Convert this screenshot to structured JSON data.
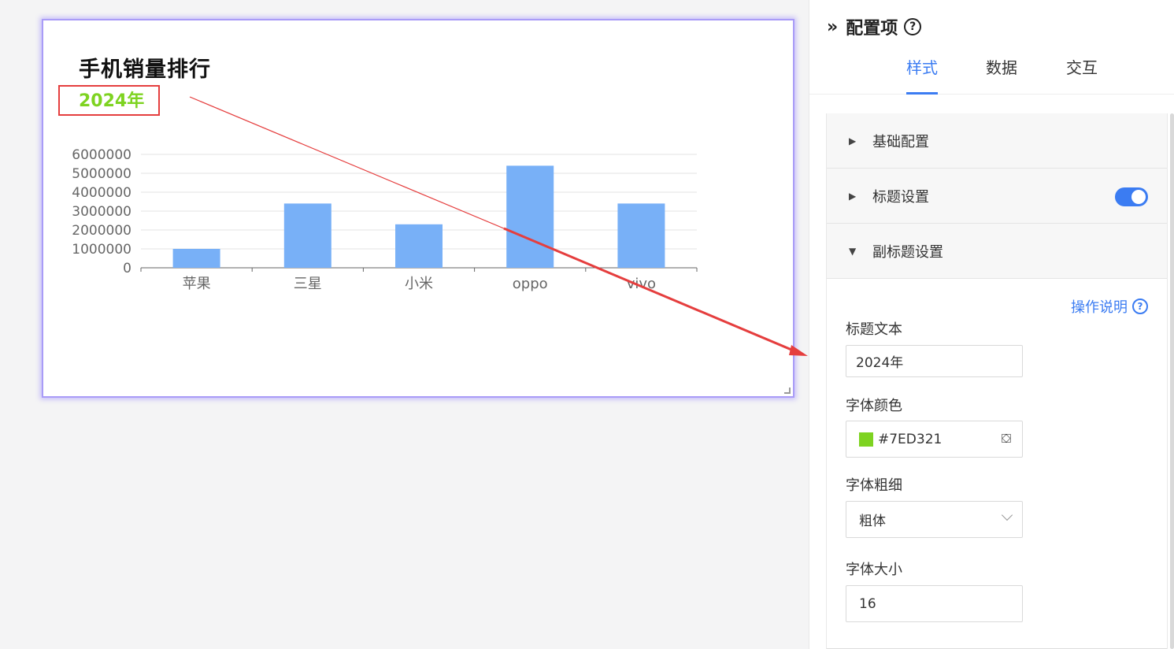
{
  "chart": {
    "title": "手机销量排行",
    "subtitle": "2024年",
    "subtitle_color": "#7ED321"
  },
  "chart_data": {
    "type": "bar",
    "categories": [
      "苹果",
      "三星",
      "小米",
      "oppo",
      "vivo"
    ],
    "values": [
      1000000,
      3400000,
      2300000,
      5400000,
      3400000
    ],
    "yticks": [
      "6000000",
      "5000000",
      "4000000",
      "3000000",
      "2000000",
      "1000000",
      "0"
    ],
    "ylim": [
      0,
      6000000
    ],
    "grid": true,
    "bar_color": "#78b0f7"
  },
  "panel": {
    "title": "配置项",
    "collapse_icon": "»",
    "tabs": [
      {
        "label": "样式",
        "active": true
      },
      {
        "label": "数据",
        "active": false
      },
      {
        "label": "交互",
        "active": false
      }
    ],
    "sections": {
      "basic": "基础配置",
      "title_settings": "标题设置",
      "subtitle_settings": "副标题设置"
    },
    "help_link": "操作说明",
    "fields": {
      "title_text_label": "标题文本",
      "title_text_value": "2024年",
      "font_color_label": "字体颜色",
      "font_color_value": "#7ED321",
      "font_weight_label": "字体粗细",
      "font_weight_value": "粗体",
      "font_size_label": "字体大小",
      "font_size_value": "16"
    }
  }
}
